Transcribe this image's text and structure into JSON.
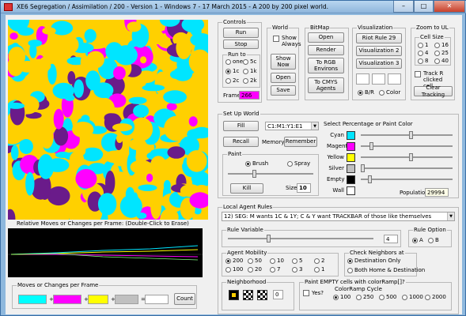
{
  "window": {
    "title": "XE6 Segregation / Assimilation / 200 - Version 1 - Windows 7 - 17 March 2015 - A 200 by 200 pixel world.",
    "min": "–",
    "max": "□",
    "close": "✕"
  },
  "controls": {
    "caption": "Controls",
    "run": "Run",
    "stop": "Stop",
    "run_to": "Run to",
    "run_opts": [
      "one",
      "5c",
      "1c",
      "1k",
      "2c",
      "2k"
    ],
    "frame_label": "Frame",
    "frame_value": "266"
  },
  "world": {
    "caption": "World",
    "show_always": "Show Always",
    "show_now": "Show Now",
    "open": "Open",
    "save": "Save"
  },
  "bitmap": {
    "caption": "BitMap",
    "open": "Open",
    "render": "Render",
    "to_rgb": "To RGB Environs",
    "to_cmys": "To CMYS Agents"
  },
  "visualization": {
    "caption": "Visualization",
    "riot": "Riot Rule 29",
    "vis2": "Visualization 2",
    "vis3": "Visualization 3",
    "bw": "B/R",
    "color": "Color"
  },
  "zoom": {
    "caption": "Zoom to UL",
    "cell_size": "Cell Size",
    "sizes": [
      "1",
      "16",
      "4",
      "25",
      "8",
      "40"
    ],
    "track_label": "Track R clicked cell",
    "clear": "Clear Tracking"
  },
  "setup": {
    "caption": "Set Up World",
    "fill": "Fill",
    "combo": "C1:M1:Y1:E1",
    "recall": "Recall",
    "memory": "Memory",
    "remember": "Remember",
    "paint": "Paint",
    "brush": "Brush",
    "spray": "Spray",
    "kill": "Kill",
    "size_label": "Size",
    "size_value": "10"
  },
  "colors": {
    "caption": "Select Percentage or Paint Color",
    "rows": [
      {
        "name": "Cyan",
        "color": "#00e5ff",
        "thumb": 0.55
      },
      {
        "name": "Magenta",
        "color": "#ff00ff",
        "thumb": 0.1
      },
      {
        "name": "Yellow",
        "color": "#ffff00",
        "thumb": 0.55
      },
      {
        "name": "Silver",
        "color": "#c0c0c0",
        "thumb": 0.0
      },
      {
        "name": "Empty",
        "color": "#000000",
        "thumb": 0.08
      },
      {
        "name": "Wall",
        "color": "#ffffff",
        "thumb": null
      }
    ],
    "population_label": "Population",
    "population_value": "29994"
  },
  "plot": {
    "caption": "Relative Moves or Changes per Frame:  (Double-Click to Erase)"
  },
  "moves": {
    "caption": "Moves or Changes per Frame",
    "plus": "+",
    "eq": "=",
    "count": "Count",
    "colors": [
      "#00ffff",
      "#ff00ff",
      "#ffff00",
      "#c0c0c0",
      "#ffffff"
    ]
  },
  "agent": {
    "caption": "Local Agent Rules",
    "rule": "12) SEG: M wants 1C & 1Y; C & Y want TRACKBAR of those like themselves",
    "rule_variable": "Rule Variable",
    "rule_value": "4",
    "rule_option": "Rule Option",
    "opt_a": "A",
    "opt_b": "B"
  },
  "mobility": {
    "caption": "Agent Mobility",
    "values": [
      "200",
      "50",
      "10",
      "5",
      "2",
      "100",
      "20",
      "7",
      "3",
      "1"
    ]
  },
  "neighbors": {
    "caption": "Check Neighbors at",
    "dest": "Destination Only",
    "both": "Both Home & Destination"
  },
  "hood": {
    "caption": "Neighborhood",
    "value": "0"
  },
  "paintempty": {
    "caption": "Paint EMPTY cells with colorRamp[]?",
    "yes": "Yes?",
    "ramp": "ColorRamp Cycle",
    "values": [
      "100",
      "250",
      "500",
      "1000",
      "2000"
    ]
  }
}
